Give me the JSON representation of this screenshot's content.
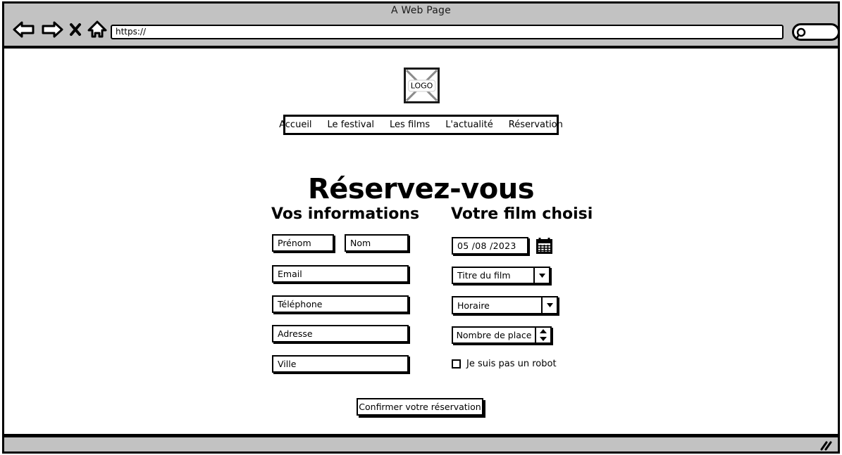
{
  "browser": {
    "title": "A Web Page",
    "url_value": "https://",
    "url_placeholder": "https://",
    "icons": {
      "back": "back-arrow-icon",
      "forward": "forward-arrow-icon",
      "stop": "close-x-icon",
      "home": "home-icon",
      "search": "search-icon",
      "resize": "resize-grip-icon"
    }
  },
  "site": {
    "logo_label": "LOGO",
    "nav": [
      {
        "label": "Accueil"
      },
      {
        "label": "Le festival"
      },
      {
        "label": "Les films"
      },
      {
        "label": "L'actualité"
      },
      {
        "label": "Réservation"
      }
    ]
  },
  "page": {
    "title": "Réservez-vous",
    "left_column": {
      "heading": "Vos informations",
      "fields": [
        {
          "name": "prenom",
          "value": "Prénom"
        },
        {
          "name": "nom",
          "value": "Nom"
        },
        {
          "name": "email",
          "value": "Email"
        },
        {
          "name": "telephone",
          "value": "Téléphone"
        },
        {
          "name": "adresse",
          "value": "Adresse"
        },
        {
          "name": "ville",
          "value": "Ville"
        }
      ]
    },
    "right_column": {
      "heading": "Votre film choisi",
      "date_value": "05 /08 /2023",
      "film_select": "Titre du film",
      "horaire_select": "Horaire",
      "places_stepper": "Nombre de place",
      "robot_checkbox_label": "Je suis pas un robot",
      "robot_checked": false
    },
    "submit_label": "Confirmer votre réservation"
  },
  "colors": {
    "chrome": "#c2c2c2",
    "line": "#000000",
    "page_bg": "#ffffff"
  }
}
